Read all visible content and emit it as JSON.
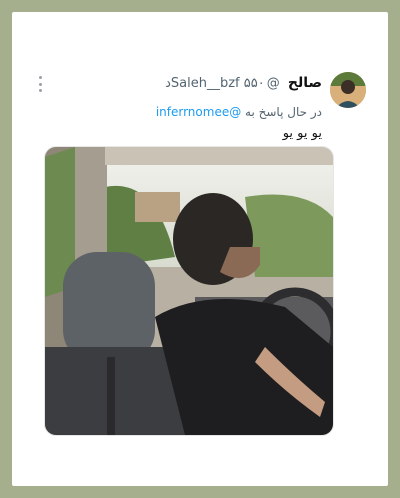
{
  "tweet": {
    "display_name": "صالح",
    "handle": "@Saleh__bzf",
    "time": "۵۵۰د",
    "reply_prefix": "در حال پاسخ به",
    "reply_to": "@inferrnomee",
    "text": "یو یو یو"
  },
  "icons": {
    "more": "more-vertical-icon",
    "avatar": "user-avatar"
  },
  "colors": {
    "background": "#a5ae8d",
    "card": "#ffffff",
    "accent": "#1d9bf0",
    "secondary_text": "#536471"
  }
}
